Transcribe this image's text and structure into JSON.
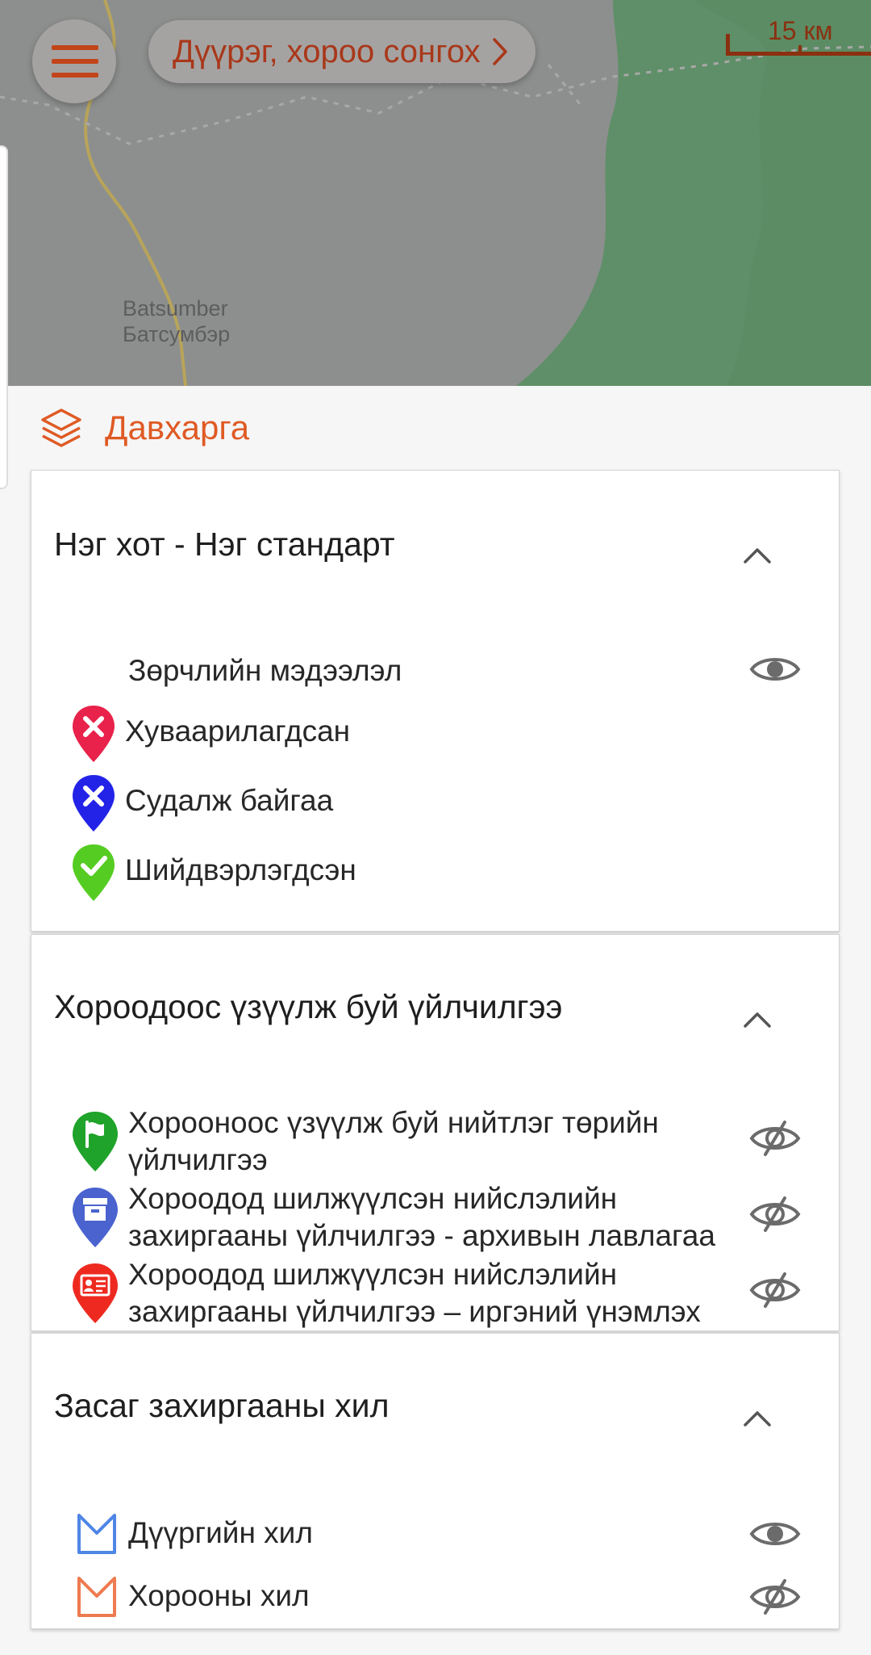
{
  "map": {
    "district_selector_label": "Дүүрэг, хороо сонгох",
    "scale_label": "15 км",
    "place_name_latin": "Batsumber",
    "place_name_cyrillic": "Батсумбэр"
  },
  "layers": {
    "title": "Давхарга"
  },
  "sections": [
    {
      "title": "Нэг хот - Нэг стандарт",
      "group_label": "Зөрчлийн мэдээлэл",
      "group_visible": true,
      "legend": [
        {
          "label": "Хуваарилагдсан",
          "color": "#e8224a",
          "icon": "x-pin-icon"
        },
        {
          "label": "Судалж байгаа",
          "color": "#2323e8",
          "icon": "x-pin-icon"
        },
        {
          "label": "Шийдвэрлэгдсэн",
          "color": "#55cc22",
          "icon": "check-pin-icon"
        }
      ]
    },
    {
      "title": "Хороодоос үзүүлж буй үйлчилгээ",
      "items": [
        {
          "line1": "Хорооноос үзүүлж буй нийтлэг төрийн",
          "line2": "үйлчилгээ",
          "color": "#1fa32a",
          "icon": "flag-pin-icon",
          "visible": false
        },
        {
          "line1": "Хороодод шилжүүлсэн нийслэлийн",
          "line2": "захиргааны үйлчилгээ - архивын лавлагаа",
          "color": "#4a63cf",
          "icon": "archive-pin-icon",
          "visible": false
        },
        {
          "line1": "Хороодод шилжүүлсэн нийслэлийн",
          "line2": "захиргааны үйлчилгээ – иргэний үнэмлэх",
          "color": "#ee2a20",
          "icon": "id-card-pin-icon",
          "visible": false
        }
      ]
    },
    {
      "title": "Засаг захиргааны хил",
      "items": [
        {
          "label": "Дүүргийн хил",
          "color": "#4f86e6",
          "icon": "district-boundary-icon",
          "visible": true
        },
        {
          "label": "Хорооны хил",
          "color": "#ee7a50",
          "icon": "khoroo-boundary-icon",
          "visible": false
        }
      ]
    }
  ],
  "colors": {
    "accent": "#df5a24",
    "map_button_text": "#a8381a",
    "eye_icon": "#6b6b6b"
  }
}
